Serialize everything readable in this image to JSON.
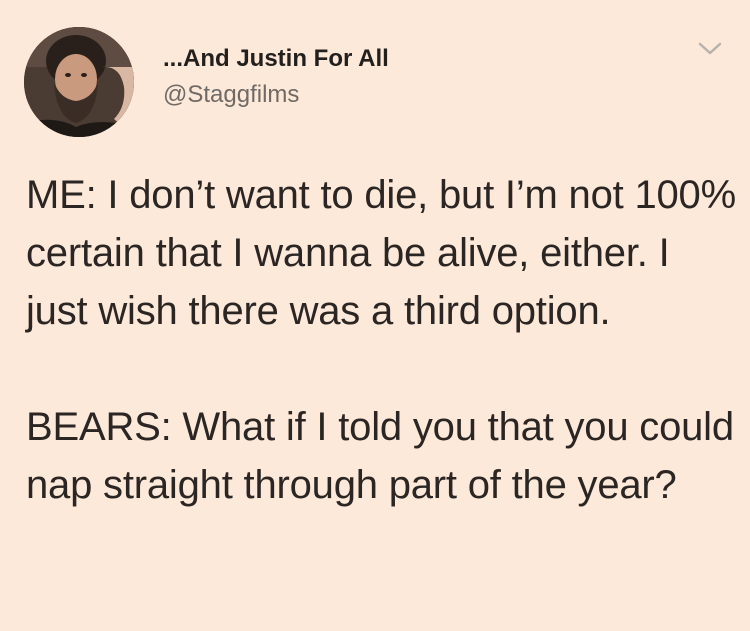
{
  "tweet": {
    "author": {
      "display_name": "...And Justin For All",
      "handle": "@Staggfilms"
    },
    "menu_icon": "chevron-down-icon",
    "text": {
      "paragraph_1": "ME: I don’t want to die, but I’m not 100% certain that I wanna be alive, either. I just wish there was a third option.",
      "paragraph_2": "BEARS: What if I told you that you could nap straight through part of the year?"
    }
  },
  "colors": {
    "background": "#fde9d9",
    "text": "#2b2624",
    "handle": "#6f6a66",
    "chevron": "#b8b2ad"
  }
}
